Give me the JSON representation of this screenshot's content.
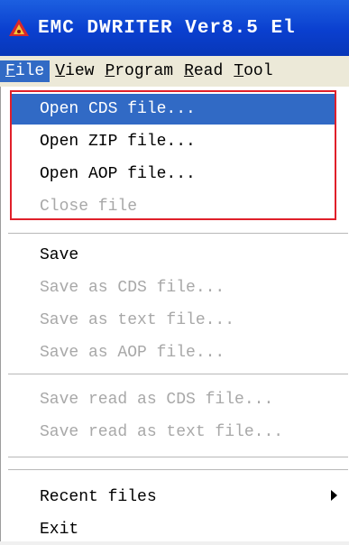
{
  "window": {
    "title": "EMC DWRITER Ver8.5  El"
  },
  "menubar": {
    "items": [
      {
        "label": "File",
        "mnemonic": "F"
      },
      {
        "label": "View",
        "mnemonic": "V"
      },
      {
        "label": "Program",
        "mnemonic": "P"
      },
      {
        "label": "Read",
        "mnemonic": "R"
      },
      {
        "label": "Tool",
        "mnemonic": "T"
      }
    ]
  },
  "file_menu": {
    "items": [
      {
        "label": "Open CDS file...",
        "enabled": true,
        "selected": true
      },
      {
        "label": "Open ZIP  file...",
        "enabled": true
      },
      {
        "label": "Open AOP  file...",
        "enabled": true
      },
      {
        "label": "Close file",
        "enabled": false
      },
      {
        "label": "Save",
        "enabled": true
      },
      {
        "label": "Save as CDS file...",
        "enabled": false
      },
      {
        "label": "Save as text file...",
        "enabled": false
      },
      {
        "label": "Save as AOP file...",
        "enabled": false
      },
      {
        "label": "Save read as CDS file...",
        "enabled": false
      },
      {
        "label": "Save read as text file...",
        "enabled": false
      },
      {
        "label": "Recent files",
        "enabled": true,
        "submenu": true
      },
      {
        "label": "Exit",
        "enabled": true
      }
    ]
  },
  "colors": {
    "title_bar": "#0a3fcf",
    "selection": "#316ac5",
    "annotation_box": "#e0202a",
    "disabled_text": "#a8a8a8"
  }
}
